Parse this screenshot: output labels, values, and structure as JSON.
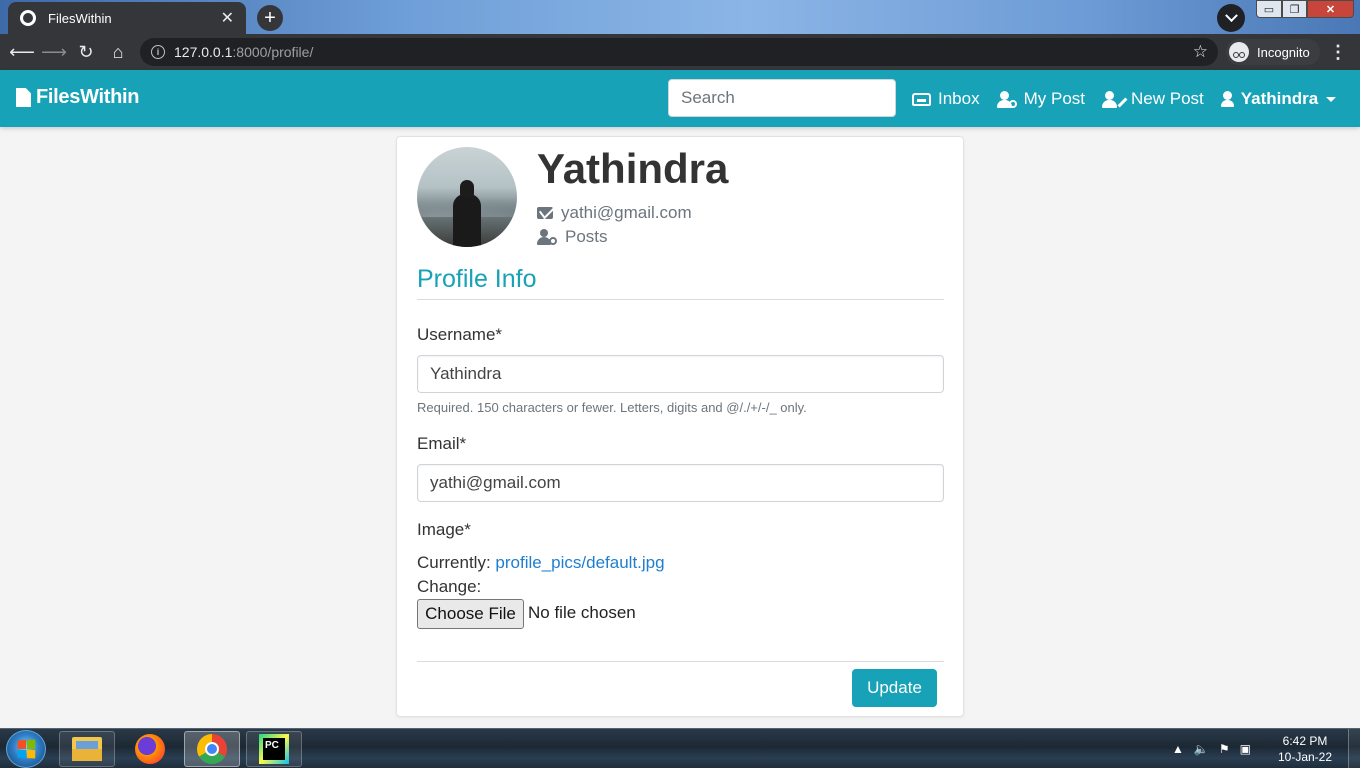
{
  "browser": {
    "tab_title": "FilesWithin",
    "tab_close": "✕",
    "new_tab": "+",
    "url_host": "127.0.0.1",
    "url_path": ":8000/profile/",
    "incognito_label": "Incognito",
    "window_controls": {
      "minimize": "▭",
      "maximize": "❐",
      "close": "✕"
    }
  },
  "navbar": {
    "brand": "FilesWithin",
    "search_placeholder": "Search",
    "links": {
      "inbox": "Inbox",
      "my_post": "My Post",
      "new_post": "New Post",
      "user": "Yathindra"
    },
    "color": "#17a2b8"
  },
  "profile": {
    "name": "Yathindra",
    "email": "yathi@gmail.com",
    "posts_label": "Posts"
  },
  "form": {
    "section_title": "Profile Info",
    "username_label": "Username*",
    "username_value": "Yathindra",
    "username_help": "Required. 150 characters or fewer. Letters, digits and @/./+/-/_ only.",
    "email_label": "Email*",
    "email_value": "yathi@gmail.com",
    "image_label": "Image*",
    "currently_label": "Currently:",
    "currently_link": "profile_pics/default.jpg",
    "change_label": "Change:",
    "file_button": "Choose File",
    "file_status": "No file chosen",
    "submit_label": "Update"
  },
  "taskbar": {
    "apps": [
      "file-explorer",
      "firefox",
      "chrome",
      "pycharm"
    ],
    "time": "6:42 PM",
    "date": "10-Jan-22"
  },
  "colors": {
    "accent": "#17a2b8",
    "link": "#1e7fd0"
  }
}
